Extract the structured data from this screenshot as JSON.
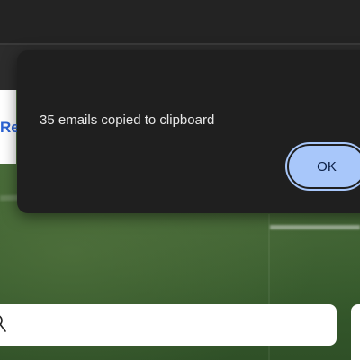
{
  "page": {
    "link_fragment": "Re"
  },
  "dialog": {
    "message": "35 emails copied to clipboard",
    "ok_label": "OK"
  },
  "colors": {
    "dialog_bg": "#1f1f1f",
    "button_bg": "#a8c7fa",
    "button_text": "#0b1f45",
    "link": "#2a62d4"
  },
  "icons": {
    "search": "search-icon"
  }
}
